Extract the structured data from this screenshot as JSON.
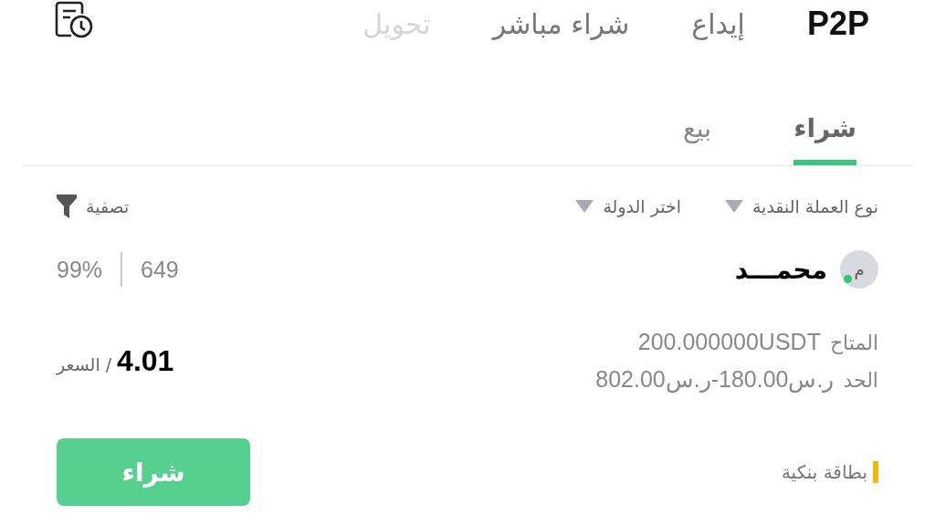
{
  "top_nav": {
    "tabs": [
      {
        "label": "P2P",
        "selected": true,
        "faded": false
      },
      {
        "label": "إيداع",
        "selected": false,
        "faded": false
      },
      {
        "label": "شراء مباشر",
        "selected": false,
        "faded": false
      },
      {
        "label": "تحويل",
        "selected": false,
        "faded": true
      }
    ]
  },
  "trade_tabs": [
    {
      "label": "شراء",
      "selected": true
    },
    {
      "label": "بيع",
      "selected": false
    }
  ],
  "filters": {
    "dropdowns": [
      "نوع العملة النقدية",
      "اختر الدولة"
    ],
    "filter_label": "تصفية"
  },
  "offer": {
    "avatar_letter": "م",
    "online": true,
    "merchant": "محمـــد",
    "orders": "649",
    "completion": "99%",
    "available_label": "المتاح",
    "available": "200.000000USDT",
    "limit_label": "الحد",
    "limit": "ر.س180.00-ر.س802.00",
    "price_label": "السعر",
    "price_separator": "/",
    "price": "4.01",
    "payment_methods": [
      {
        "name": "بطاقة بنكية",
        "color": "#f0b90b"
      }
    ],
    "action": "شراء"
  }
}
